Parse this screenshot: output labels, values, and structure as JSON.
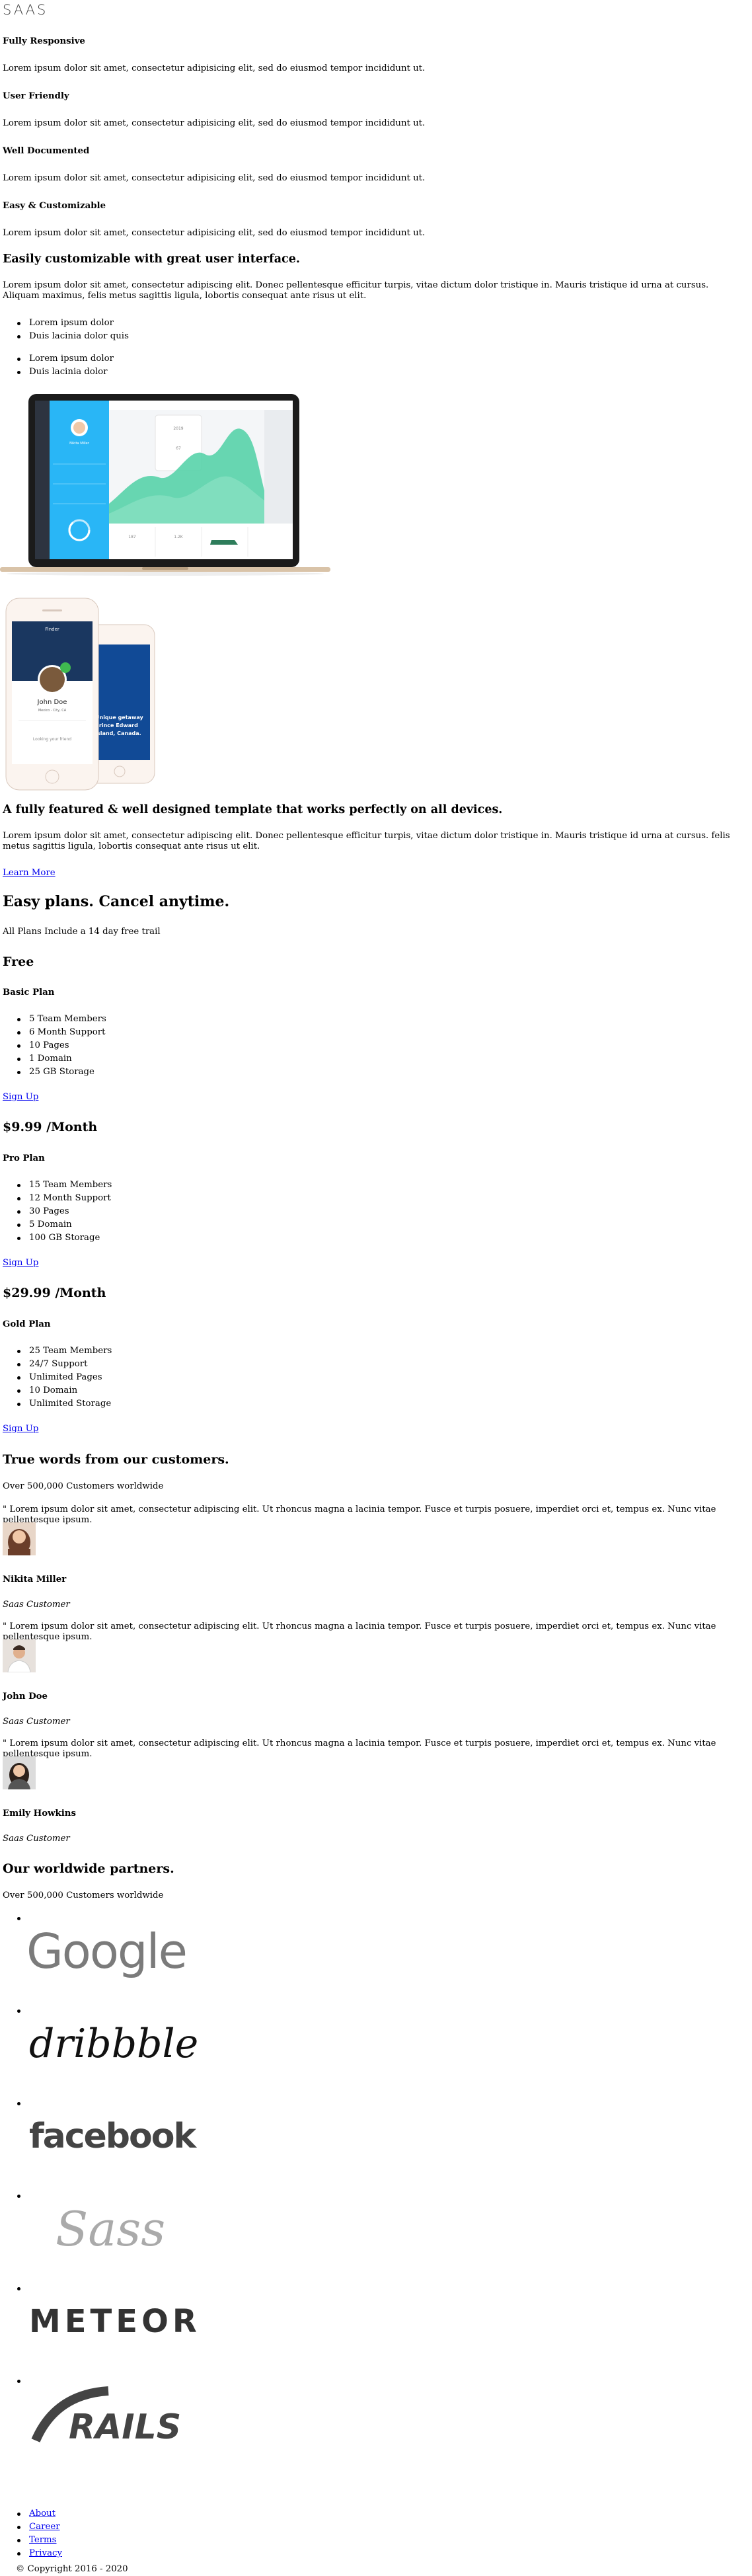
{
  "brand": {
    "logo": "SAAS"
  },
  "features": [
    {
      "title": "Fully Responsive",
      "text": "Lorem ipsum dolor sit amet, consectetur adipisicing elit, sed do eiusmod tempor incididunt ut."
    },
    {
      "title": "User Friendly",
      "text": "Lorem ipsum dolor sit amet, consectetur adipisicing elit, sed do eiusmod tempor incididunt ut."
    },
    {
      "title": "Well Documented",
      "text": "Lorem ipsum dolor sit amet, consectetur adipisicing elit, sed do eiusmod tempor incididunt ut."
    },
    {
      "title": "Easy & Customizable",
      "text": "Lorem ipsum dolor sit amet, consectetur adipisicing elit, sed do eiusmod tempor incididunt ut."
    }
  ],
  "customize": {
    "heading": "Easily customizable with great user interface.",
    "text": "Lorem ipsum dolor sit amet, consectetur adipiscing elit. Donec pellentesque efficitur turpis, vitae dictum dolor tristique in. Mauris tristique id urna at cursus. Aliquam maximus, felis metus sagittis ligula, lobortis consequat ante risus ut elit.",
    "list1": [
      "Lorem ipsum dolor",
      "Duis lacinia dolor quis"
    ],
    "list2": [
      "Lorem ipsum dolor",
      "Duis lacinia dolor"
    ]
  },
  "laptop_screen": {
    "profile_name": "Nikita Miller",
    "stats": [
      "2019",
      "67",
      "187",
      "1.2K"
    ],
    "labels": [
      "Nearby",
      "Profile",
      "Account",
      "Favorites"
    ]
  },
  "phone_screen": {
    "brand": "Finder",
    "name": "John Doe",
    "role": "Mexico - City, CA",
    "search": "Looking your friend",
    "overlay": "Unique getaway\nPrince Edward\nIsland, Canada."
  },
  "devices": {
    "heading": "A fully featured & well designed template that works perfectly on all devices.",
    "text": "Lorem ipsum dolor sit amet, consectetur adipiscing elit. Donec pellentesque efficitur turpis, vitae dictum dolor tristique in. Mauris tristique id urna at cursus. felis metus sagittis ligula, lobortis consequat ante risus ut elit.",
    "cta": "Learn More"
  },
  "pricing": {
    "heading": "Easy plans. Cancel anytime.",
    "subheading": "All Plans Include a 14 day free trail",
    "plans": [
      {
        "price": "Free",
        "name": "Basic Plan",
        "features": [
          "5 Team Members",
          "6 Month Support",
          "10 Pages",
          "1 Domain",
          "25 GB Storage"
        ],
        "cta": "Sign Up"
      },
      {
        "price": "$9.99 /Month",
        "name": "Pro Plan",
        "features": [
          "15 Team Members",
          "12 Month Support",
          "30 Pages",
          "5 Domain",
          "100 GB Storage"
        ],
        "cta": "Sign Up"
      },
      {
        "price": "$29.99 /Month",
        "name": "Gold Plan",
        "features": [
          "25 Team Members",
          "24/7 Support",
          "Unlimited Pages",
          "10 Domain",
          "Unlimited Storage"
        ],
        "cta": "Sign Up"
      }
    ]
  },
  "testimonials": {
    "heading": "True words from our customers.",
    "subheading": "Over 500,000 Customers worldwide",
    "items": [
      {
        "quote": "\" Lorem ipsum dolor sit amet, consectetur adipiscing elit. Ut rhoncus magna a lacinia tempor. Fusce et turpis posuere, imperdiet orci et, tempus ex. Nunc vitae pellentesque ipsum.",
        "name": "Nikita Miller",
        "role": "Saas Customer"
      },
      {
        "quote": "\" Lorem ipsum dolor sit amet, consectetur adipiscing elit. Ut rhoncus magna a lacinia tempor. Fusce et turpis posuere, imperdiet orci et, tempus ex. Nunc vitae pellentesque ipsum.",
        "name": "John Doe",
        "role": "Saas Customer"
      },
      {
        "quote": "\" Lorem ipsum dolor sit amet, consectetur adipiscing elit. Ut rhoncus magna a lacinia tempor. Fusce et turpis posuere, imperdiet orci et, tempus ex. Nunc vitae pellentesque ipsum.",
        "name": "Emily Howkins",
        "role": "Saas Customer"
      }
    ]
  },
  "partners": {
    "heading": "Our worldwide partners.",
    "subheading": "Over 500,000 Customers worldwide",
    "logos": [
      "Google",
      "dribbble",
      "facebook",
      "Sass",
      "METEOR",
      "RAILS"
    ]
  },
  "footer": {
    "links": [
      "About",
      "Career",
      "Terms",
      "Privacy"
    ],
    "copyright": "© Copyright 2016 - 2020"
  },
  "colors": {
    "link": "#0000ee",
    "laptop_accent": "#29b6f6",
    "chart_green": "#4dd0a5",
    "phone_accent": "#3fb950"
  }
}
